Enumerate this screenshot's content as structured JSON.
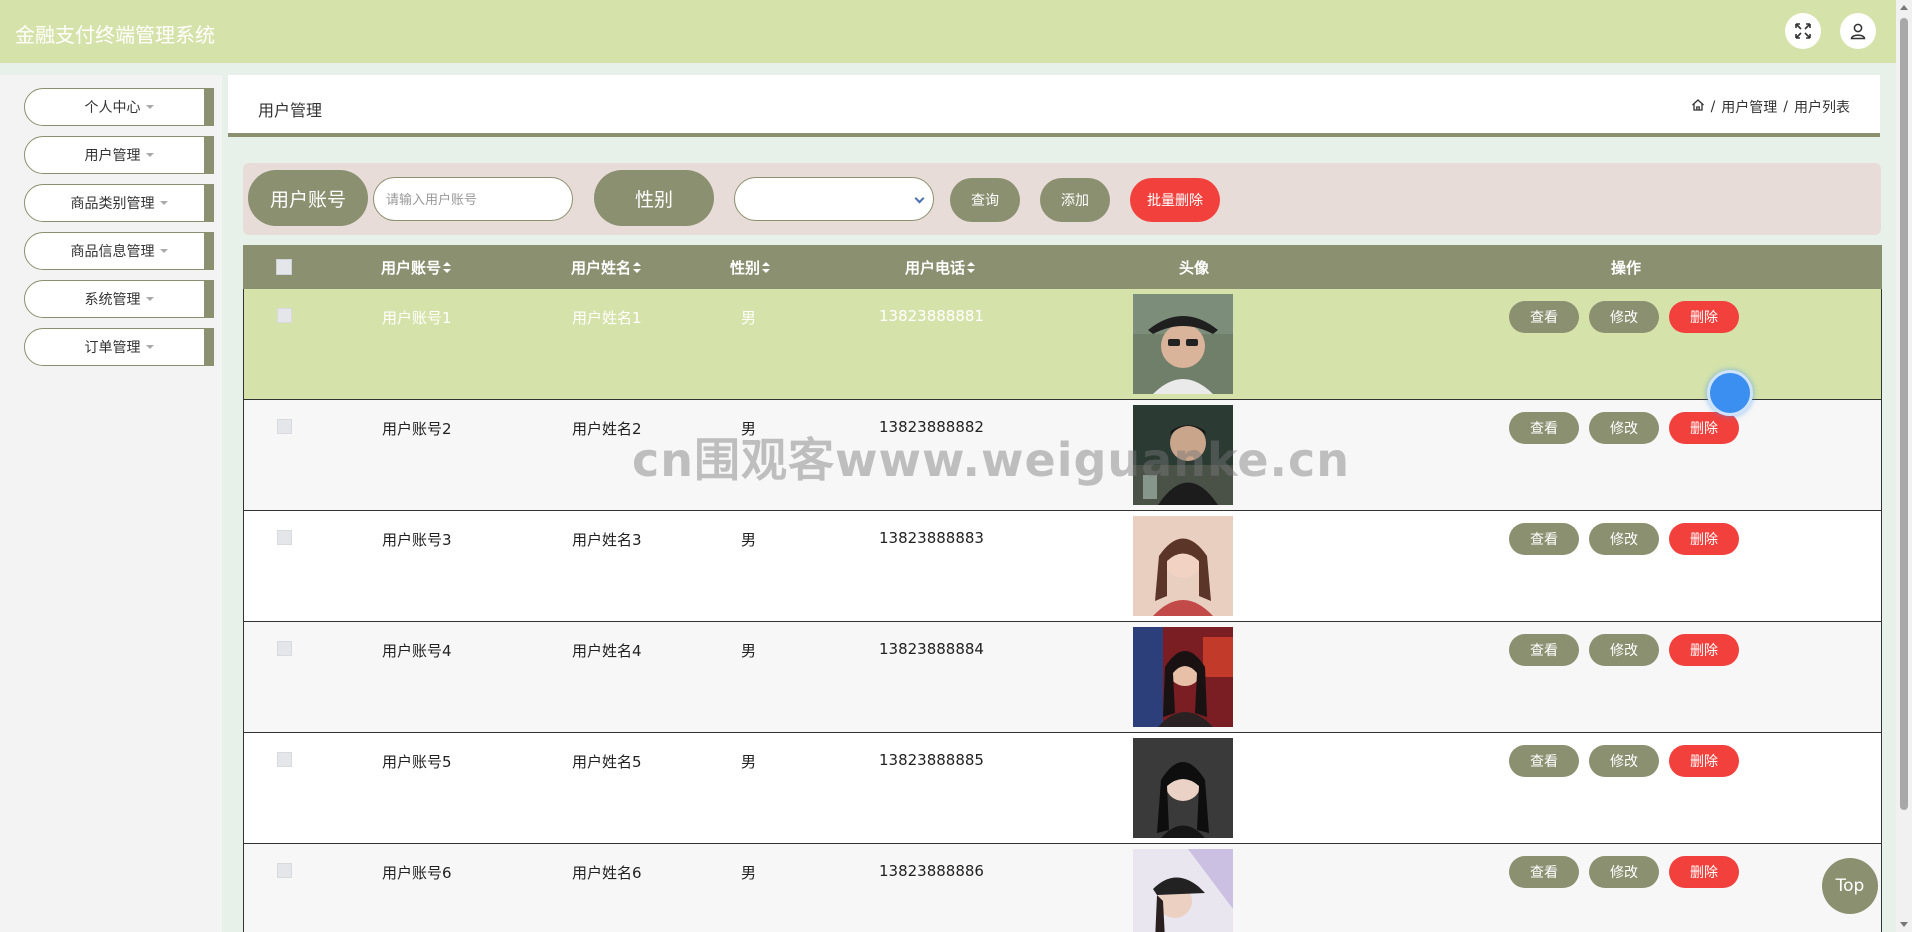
{
  "app": {
    "title": "金融支付终端管理系统"
  },
  "topbar": {
    "fullscreen_icon": "expand-icon",
    "user_icon": "user-icon"
  },
  "sidebar": {
    "items": [
      {
        "label": "个人中心"
      },
      {
        "label": "用户管理"
      },
      {
        "label": "商品类别管理"
      },
      {
        "label": "商品信息管理"
      },
      {
        "label": "系统管理"
      },
      {
        "label": "订单管理"
      }
    ]
  },
  "header": {
    "title": "用户管理",
    "breadcrumb": {
      "home_icon": "home-icon",
      "sep": "/",
      "item1": "用户管理",
      "item2": "用户列表"
    }
  },
  "search": {
    "account_label": "用户账号",
    "account_placeholder": "请输入用户账号",
    "gender_label": "性别",
    "gender_value": "",
    "query_button": "查询",
    "add_button": "添加",
    "batch_delete_button": "批量删除"
  },
  "table": {
    "columns": [
      "用户账号",
      "用户姓名",
      "性别",
      "用户电话",
      "头像",
      "操作"
    ],
    "rows": [
      {
        "account": "用户账号1",
        "name": "用户姓名1",
        "gender": "男",
        "phone": "13823888881",
        "selected": true
      },
      {
        "account": "用户账号2",
        "name": "用户姓名2",
        "gender": "男",
        "phone": "13823888882"
      },
      {
        "account": "用户账号3",
        "name": "用户姓名3",
        "gender": "男",
        "phone": "13823888883"
      },
      {
        "account": "用户账号4",
        "name": "用户姓名4",
        "gender": "男",
        "phone": "13823888884"
      },
      {
        "account": "用户账号5",
        "name": "用户姓名5",
        "gender": "男",
        "phone": "13823888885"
      },
      {
        "account": "用户账号6",
        "name": "用户姓名6",
        "gender": "男",
        "phone": "13823888886"
      }
    ],
    "actions": {
      "view": "查看",
      "edit": "修改",
      "delete": "删除"
    }
  },
  "watermark": "cn围观客www.weiguanke.cn",
  "top_button": "Top",
  "colors": {
    "accent": "#8b9070",
    "topbar": "#d5e3ab",
    "danger": "#f2413d",
    "selected_row": "#d5e3ab"
  }
}
